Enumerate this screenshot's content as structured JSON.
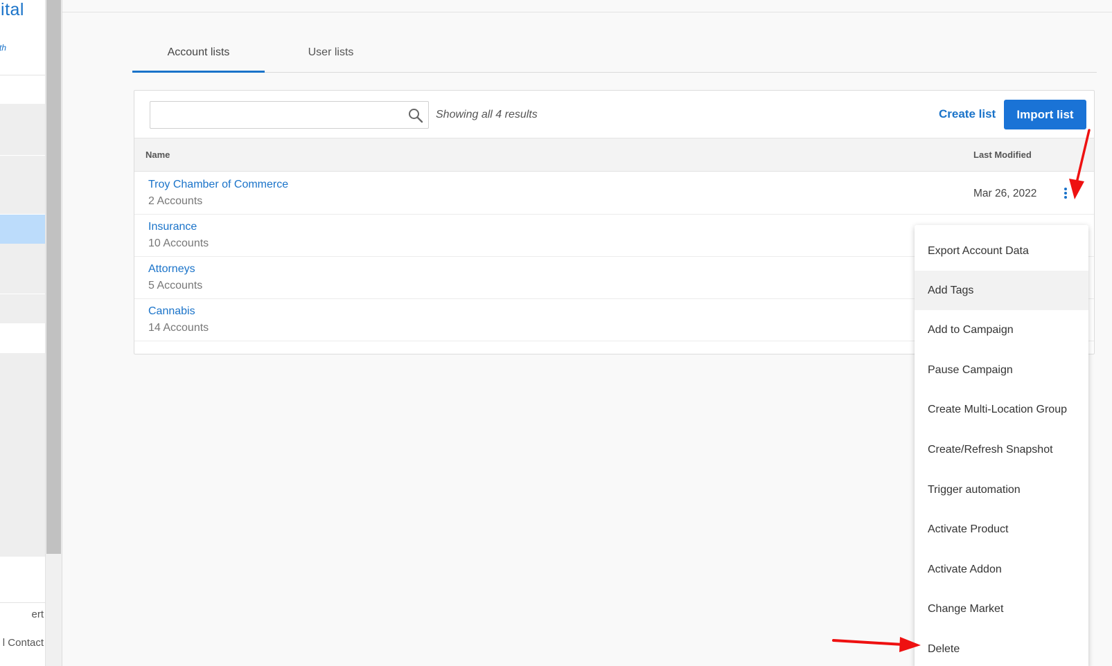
{
  "sidebar": {
    "logo_text": "ital",
    "tagline": "th",
    "items": [
      "ert",
      "l Contact"
    ]
  },
  "tabs": [
    {
      "label": "Account lists",
      "active": true
    },
    {
      "label": "User lists",
      "active": false
    }
  ],
  "toolbar": {
    "search_value": "",
    "search_placeholder": "",
    "results_text": "Showing all 4 results",
    "create_label": "Create list",
    "import_label": "Import list"
  },
  "table": {
    "columns": [
      "Name",
      "Last Modified"
    ],
    "rows": [
      {
        "name": "Troy Chamber of Commerce",
        "count": "2 Accounts",
        "modified": "Mar 26, 2022"
      },
      {
        "name": "Insurance",
        "count": "10 Accounts",
        "modified": ""
      },
      {
        "name": "Attorneys",
        "count": "5 Accounts",
        "modified": ""
      },
      {
        "name": "Cannabis",
        "count": "14 Accounts",
        "modified": ""
      }
    ]
  },
  "menu": {
    "items": [
      "Export Account Data",
      "Add Tags",
      "Add to Campaign",
      "Pause Campaign",
      "Create Multi-Location Group",
      "Create/Refresh Snapshot",
      "Trigger automation",
      "Activate Product",
      "Activate Addon",
      "Change Market",
      "Delete"
    ],
    "highlighted": "Add Tags"
  },
  "colors": {
    "accent": "#1a73c9",
    "primary_button": "#1a73d6",
    "annotation_arrow": "#ee1111"
  }
}
